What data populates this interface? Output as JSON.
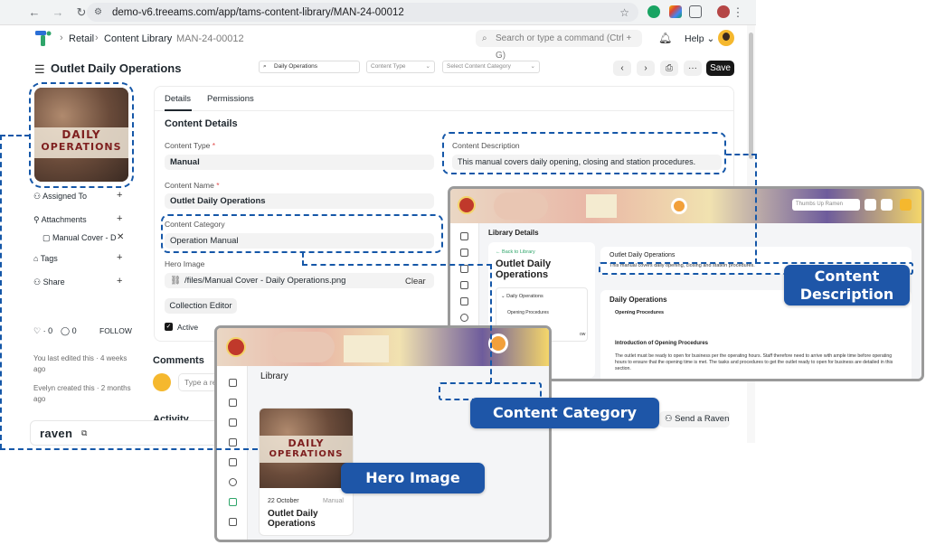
{
  "browser": {
    "url": "demo-v6.treeams.com/app/tams-content-library/MAN-24-00012"
  },
  "navbar": {
    "breadcrumbs": [
      "Retail",
      "Content Library",
      "MAN-24-00012"
    ],
    "search_placeholder": "Search or type a command (Ctrl + G)",
    "help_label": "Help"
  },
  "header": {
    "title": "Outlet Daily Operations",
    "save_label": "Save"
  },
  "sidebar": {
    "thumb_text": [
      "DAILY",
      "OPERATIONS"
    ],
    "assigned_to": "Assigned To",
    "attachments": "Attachments",
    "attachment_file": "Manual Cover - D",
    "tags": "Tags",
    "share": "Share",
    "likes": "0",
    "comments": "0",
    "follow": "FOLLOW",
    "edited_note": "You last edited this · 4 weeks ago",
    "created_note": "Evelyn created this · 2 months ago"
  },
  "form": {
    "tabs": [
      "Details",
      "Permissions"
    ],
    "section_title": "Content Details",
    "content_type_label": "Content Type",
    "content_type_value": "Manual",
    "content_name_label": "Content Name",
    "content_name_value": "Outlet Daily Operations",
    "content_category_label": "Content Category",
    "content_category_value": "Operation Manual",
    "hero_image_label": "Hero Image",
    "hero_image_value": "/files/Manual Cover - Daily Operations.png",
    "clear_label": "Clear",
    "collection_editor_label": "Collection Editor",
    "active_label": "Active",
    "content_description_label": "Content Description",
    "content_description_value": "This manual covers daily opening, closing and station procedures."
  },
  "comments": {
    "title": "Comments",
    "placeholder": "Type a re",
    "activity_title": "Activity"
  },
  "raven": {
    "brand": "raven",
    "send_label": "Send a Raven"
  },
  "overlay_right": {
    "select_label": "Thumbs Up Ramen",
    "page_title": "Library Details",
    "back_link": "← Back to Library",
    "item_title": "Outlet Daily Operations",
    "toc_item": "Daily Operations",
    "toc_sub": "Opening Procedures",
    "toc_extra": "ow",
    "desc_title": "Outlet Daily Operations",
    "desc_text": "This manual covers daily opening, closing and station procedures.",
    "section_title": "Daily Operations",
    "section_sub": "Opening Procedures",
    "intro_title": "Introduction of Opening Procedures",
    "intro_text": "The outlet must be ready to open for business per the operating hours. Staff therefore need to arrive with ample time before operating hours to ensure that the opening time is met. The tasks and procedures to get the outlet ready to open for business are detailed in this section."
  },
  "overlay_left": {
    "page_title": "Library",
    "search_value": "Daily Operations",
    "type_placeholder": "Content Type",
    "category_placeholder": "Select Content Category",
    "card_date": "22 October",
    "card_type": "Manual",
    "card_title": "Outlet Daily Operations"
  },
  "callouts": {
    "content_description": "Content Description",
    "content_category": "Content Category",
    "hero_image": "Hero Image"
  },
  "colors": {
    "annotation_blue": "#1557a8",
    "callout_bg": "#1e56a8",
    "primary_dark": "#171717",
    "brand_green": "#2fa56a",
    "brand_blue": "#2b6fd6"
  },
  "icons": {
    "back": "arrow-left-icon",
    "forward": "arrow-right-icon",
    "reload": "reload-icon",
    "star": "star-icon",
    "bell": "bell-icon",
    "search": "search-icon"
  }
}
